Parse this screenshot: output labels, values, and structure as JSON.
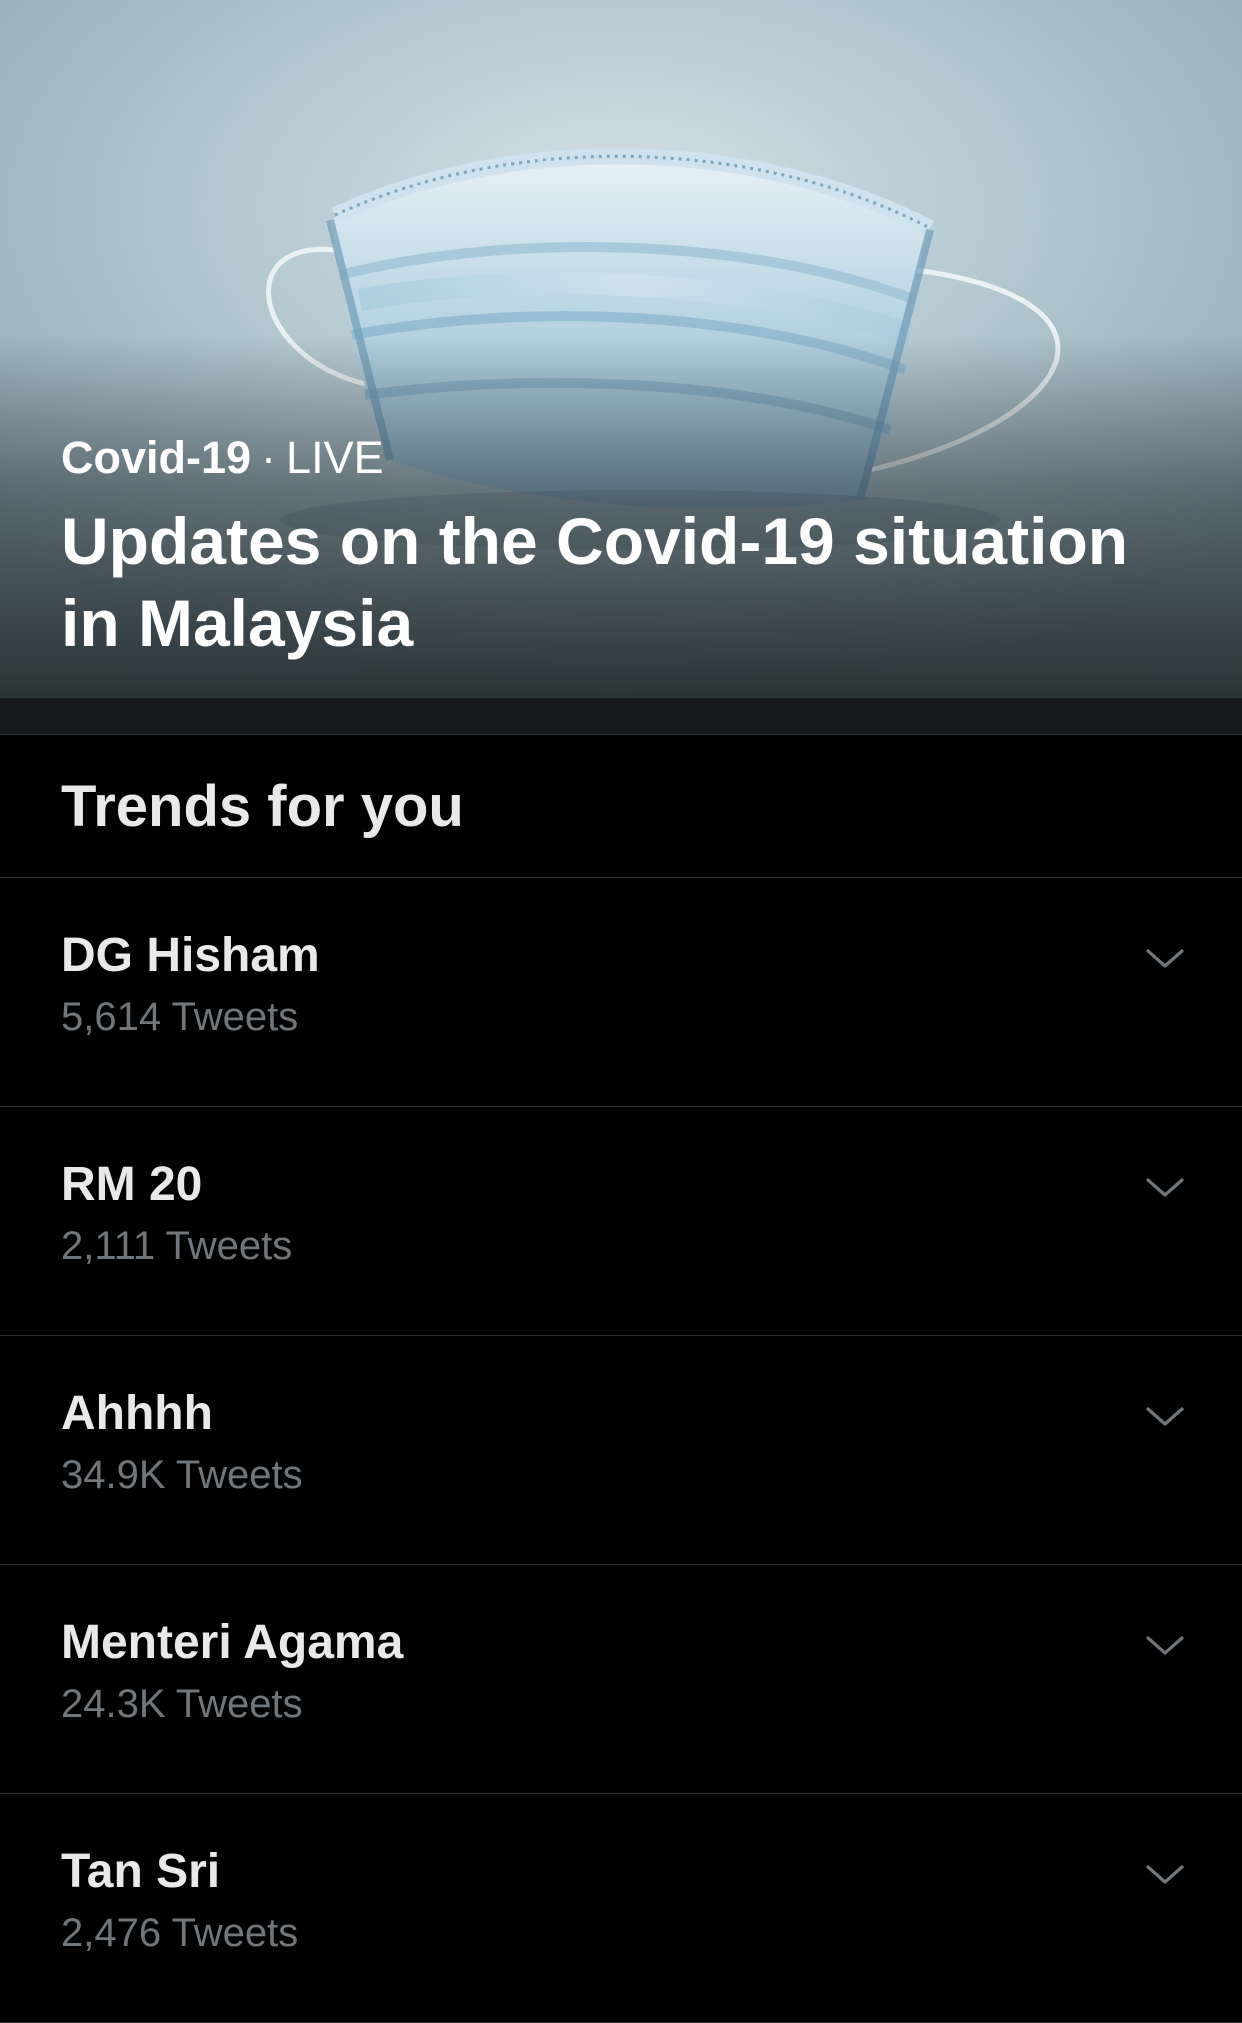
{
  "hero": {
    "topic": "Covid-19",
    "separator": "·",
    "status": "LIVE",
    "title": "Updates on the Covid-19 situation in Malaysia",
    "image": "face-mask-photo"
  },
  "trends": {
    "title": "Trends for you",
    "items": [
      {
        "name": "DG Hisham",
        "count": "5,614 Tweets"
      },
      {
        "name": "RM 20",
        "count": "2,111 Tweets"
      },
      {
        "name": "Ahhhh",
        "count": "34.9K Tweets"
      },
      {
        "name": "Menteri Agama",
        "count": "24.3K Tweets"
      },
      {
        "name": "Tan Sri",
        "count": "2,476 Tweets"
      }
    ],
    "caret_icon": "chevron-down-icon"
  },
  "colors": {
    "background": "#000000",
    "primary_text": "#e7e9ea",
    "secondary_text": "#71767b",
    "divider": "#2f3336",
    "band": "#16181c"
  }
}
